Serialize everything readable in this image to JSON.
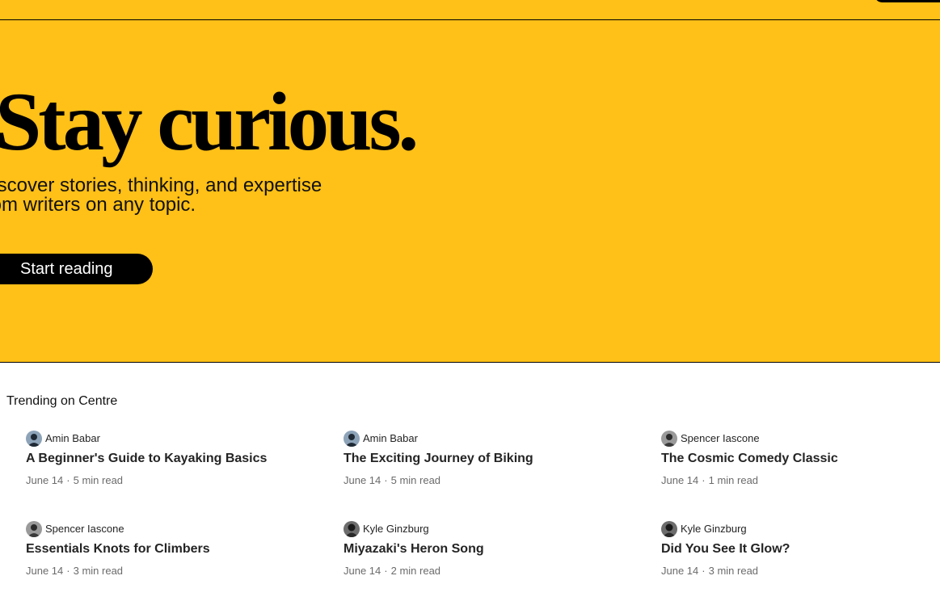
{
  "hero": {
    "title": "Stay curious.",
    "subtitle": "Discover stories, thinking, and expertise from writers on any topic.",
    "cta_label": "Start reading",
    "background_color": "#FFC017"
  },
  "trending": {
    "header": "Trending on Centre",
    "items": [
      {
        "author": "Amin Babar",
        "avatar_icon": "author-avatar-icon",
        "title": "A Beginner's Guide to Kayaking Basics",
        "date": "June 14",
        "read_time": "5 min read"
      },
      {
        "author": "Amin Babar",
        "avatar_icon": "author-avatar-icon",
        "title": "The Exciting Journey of Biking",
        "date": "June 14",
        "read_time": "5 min read"
      },
      {
        "author": "Spencer Iascone",
        "avatar_icon": "author-avatar-icon",
        "title": "The Cosmic Comedy Classic",
        "date": "June 14",
        "read_time": "1 min read"
      },
      {
        "author": "Spencer Iascone",
        "avatar_icon": "author-avatar-icon",
        "title": "Essentials Knots for Climbers",
        "date": "June 14",
        "read_time": "3 min read"
      },
      {
        "author": "Kyle Ginzburg",
        "avatar_icon": "author-avatar-icon",
        "title": "Miyazaki's Heron Song",
        "date": "June 14",
        "read_time": "2 min read"
      },
      {
        "author": "Kyle Ginzburg",
        "avatar_icon": "author-avatar-icon",
        "title": "Did You See It Glow?",
        "date": "June 14",
        "read_time": "3 min read"
      }
    ],
    "meta_separator": "·"
  }
}
